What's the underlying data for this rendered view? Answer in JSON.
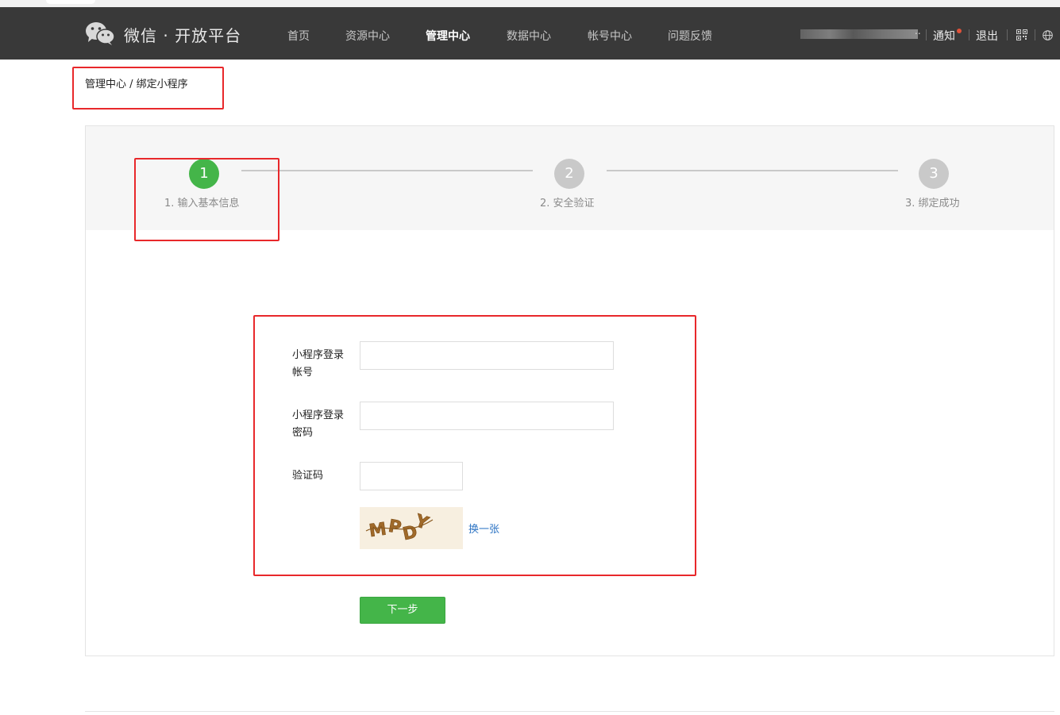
{
  "header": {
    "brand": "微信 · 开放平台",
    "nav": [
      "首页",
      "资源中心",
      "管理中心",
      "数据中心",
      "帐号中心",
      "问题反馈"
    ],
    "active_nav": "管理中心",
    "user_suffix": "..",
    "notify_label": "通知",
    "logout_label": "退出"
  },
  "breadcrumb": "管理中心 / 绑定小程序",
  "steps": [
    {
      "number": "1",
      "label": "1. 输入基本信息",
      "status": "active"
    },
    {
      "number": "2",
      "label": "2. 安全验证",
      "status": "pending"
    },
    {
      "number": "3",
      "label": "3. 绑定成功",
      "status": "pending"
    }
  ],
  "form": {
    "account_label_line1": "小程序登录",
    "account_label_line2": "帐号",
    "account_value": "",
    "password_label_line1": "小程序登录",
    "password_label_line2": "密码",
    "password_value": "",
    "captcha_label": "验证码",
    "captcha_value": "",
    "captcha_text": "MPDY",
    "refresh_label": "换一张",
    "next_label": "下一步"
  },
  "colors": {
    "header_bg": "#393939",
    "accent_green": "#44b549",
    "link_blue": "#2d74c4",
    "annotation_red": "#e8282b",
    "notify_dot": "#e0523a"
  }
}
